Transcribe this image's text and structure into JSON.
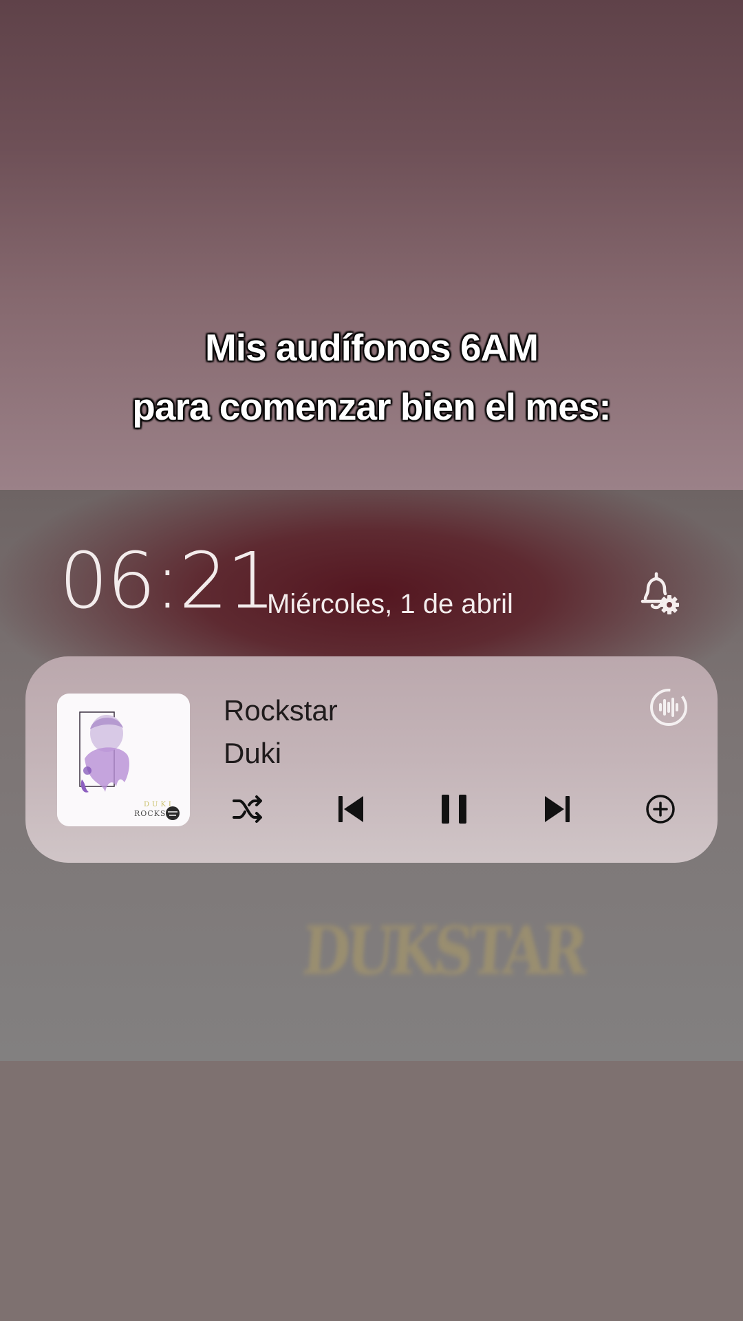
{
  "caption": {
    "line1": "Mis audífonos 6AM",
    "line2": "para comenzar bien el mes:"
  },
  "lockscreen": {
    "time": "06:21",
    "date": "Miércoles, 1 de abril",
    "bell_icon": "bell-gear-icon"
  },
  "media_player": {
    "title": "Rockstar",
    "artist": "Duki",
    "album_art_text": "DUKI ROCKSTAR",
    "controls": [
      {
        "name": "shuffle",
        "icon": "shuffle-icon"
      },
      {
        "name": "previous",
        "icon": "skip-previous-icon"
      },
      {
        "name": "pause",
        "icon": "pause-icon"
      },
      {
        "name": "next",
        "icon": "skip-next-icon"
      },
      {
        "name": "add",
        "icon": "plus-circle-icon"
      }
    ],
    "voice_icon": "audio-wave-icon"
  },
  "watermark": "DUKSTAR",
  "colors": {
    "caption_text": "#ffffff",
    "clock_text": "#f3ecec",
    "player_bg": "#c4b4b8",
    "control_color": "#000000"
  }
}
